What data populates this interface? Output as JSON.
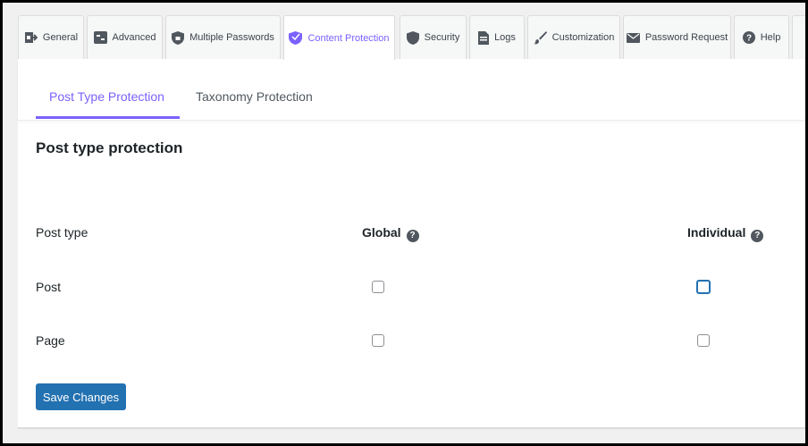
{
  "tabs": [
    {
      "label": "General",
      "icon": "login-arrow-icon"
    },
    {
      "label": "Advanced",
      "icon": "admin-generic-icon"
    },
    {
      "label": "Multiple Passwords",
      "icon": "shield-lock-icon"
    },
    {
      "label": "Content Protection",
      "icon": "shield-icon"
    },
    {
      "label": "Security",
      "icon": "shield-solid-icon"
    },
    {
      "label": "Logs",
      "icon": "document-icon"
    },
    {
      "label": "Customization",
      "icon": "paintbrush-icon"
    },
    {
      "label": "Password Request",
      "icon": "envelope-icon"
    },
    {
      "label": "Help",
      "icon": "help-icon"
    }
  ],
  "active_tab": "Content Protection",
  "subtabs": {
    "post_type": "Post Type Protection",
    "taxonomy": "Taxonomy Protection"
  },
  "section": {
    "title": "Post type protection",
    "col_post_type": "Post type",
    "col_global": "Global",
    "col_individual": "Individual",
    "help_glyph": "?",
    "rows": [
      {
        "label": "Post",
        "global": false,
        "individual": false
      },
      {
        "label": "Page",
        "global": false,
        "individual": false
      }
    ]
  },
  "save_label": "Save Changes",
  "colors": {
    "accent": "#7b61ff",
    "button": "#2271b1"
  }
}
